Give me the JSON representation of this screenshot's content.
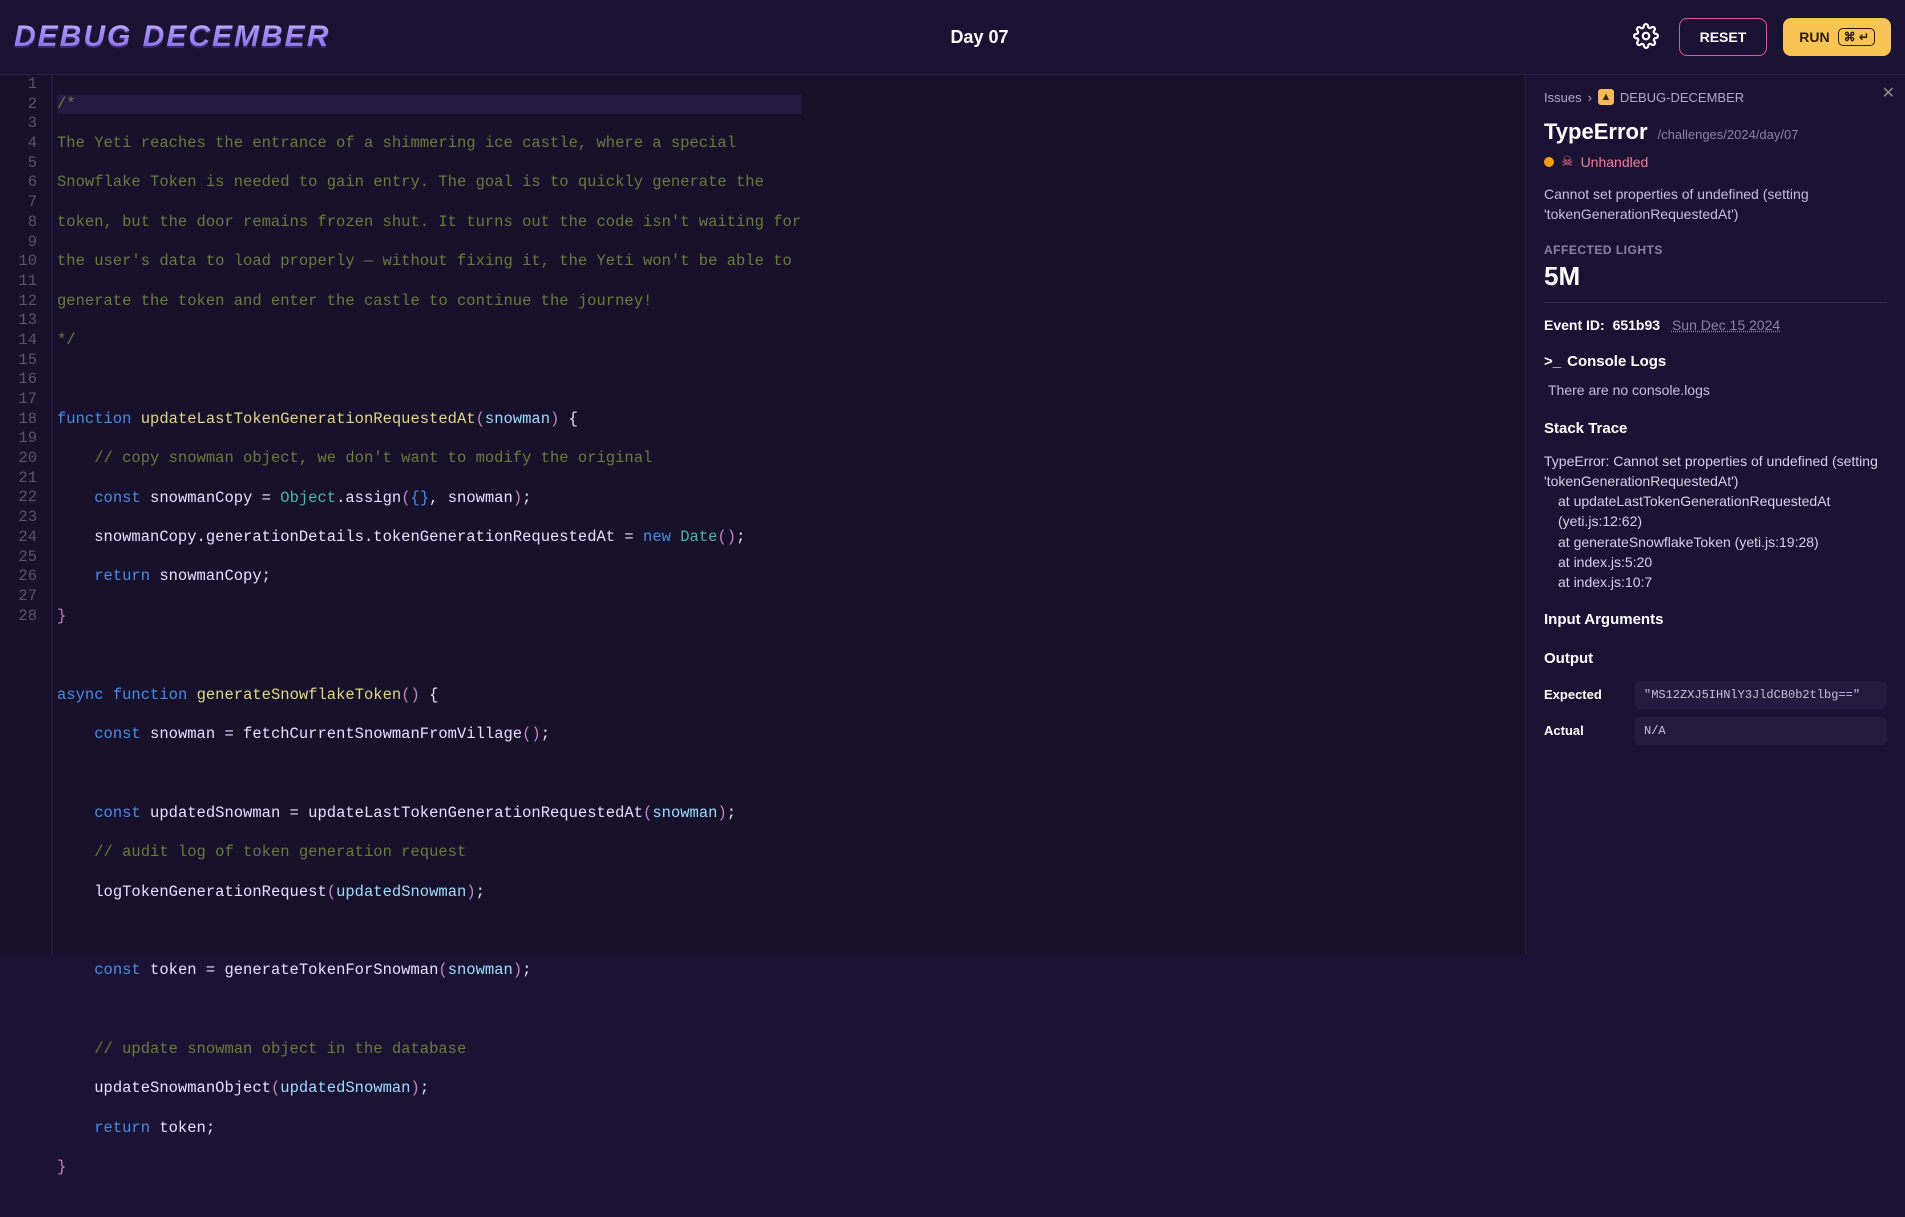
{
  "header": {
    "logo": "DEBUG DECEMBER",
    "day": "Day 07",
    "reset": "RESET",
    "run": "RUN",
    "shortcut": "⌘ ↵"
  },
  "code": {
    "lines": 28,
    "l1": "/*",
    "l2": "The Yeti reaches the entrance of a shimmering ice castle, where a special",
    "l3": "Snowflake Token is needed to gain entry. The goal is to quickly generate the",
    "l4": "token, but the door remains frozen shut. It turns out the code isn't waiting for",
    "l5": "the user's data to load properly — without fixing it, the Yeti won't be able to",
    "l6": "generate the token and enter the castle to continue the journey!",
    "l7": "*/",
    "l9a": "function",
    "l9b": "updateLastTokenGenerationRequestedAt",
    "l9c": "(",
    "l9d": "snowman",
    "l9e": ")",
    "l9f": " {",
    "l10": "// copy snowman object, we don't want to modify the original",
    "l11a": "const",
    "l11b": " snowmanCopy = ",
    "l11c": "Object",
    "l11d": ".assign",
    "l11e": "(",
    "l11f": "{}",
    "l11g": ", snowman",
    "l11h": ")",
    "l11i": ";",
    "l12a": "snowmanCopy.generationDetails.tokenGenerationRequestedAt = ",
    "l12b": "new",
    "l12c": "Date",
    "l12d": "(",
    "l12e": ")",
    "l12f": ";",
    "l13a": "return",
    "l13b": " snowmanCopy;",
    "l14": "}",
    "l16a": "async",
    "l16b": "function",
    "l16c": "generateSnowflakeToken",
    "l16d": "(",
    "l16e": ")",
    "l16f": " {",
    "l17a": "const",
    "l17b": " snowman = fetchCurrentSnowmanFromVillage",
    "l17c": "(",
    "l17d": ")",
    "l17e": ";",
    "l19a": "const",
    "l19b": " updatedSnowman = updateLastTokenGenerationRequestedAt",
    "l19c": "(",
    "l19d": "snowman",
    "l19e": ")",
    "l19f": ";",
    "l20": "// audit log of token generation request",
    "l21a": "logTokenGenerationRequest",
    "l21b": "(",
    "l21c": "updatedSnowman",
    "l21d": ")",
    "l21e": ";",
    "l23a": "const",
    "l23b": " token = generateTokenForSnowman",
    "l23c": "(",
    "l23d": "snowman",
    "l23e": ")",
    "l23f": ";",
    "l25": "// update snowman object in the database",
    "l26a": "updateSnowmanObject",
    "l26b": "(",
    "l26c": "updatedSnowman",
    "l26d": ")",
    "l26e": ";",
    "l27a": "return",
    "l27b": " token;",
    "l28": "}"
  },
  "sidebar": {
    "breadcrumb_issues": "Issues",
    "breadcrumb_project": "DEBUG-DECEMBER",
    "error_title": "TypeError",
    "error_path": "/challenges/2024/day/07",
    "unhandled": "Unhandled",
    "error_message": "Cannot set properties of undefined (setting 'tokenGenerationRequestedAt')",
    "affected_label": "AFFECTED LIGHTS",
    "affected_value": "5M",
    "event_id_label": "Event ID:",
    "event_id_value": "651b93",
    "event_date": "Sun Dec 15 2024",
    "console_header": "Console Logs",
    "console_prefix": ">_",
    "console_empty": "There are no console.logs",
    "stack_header": "Stack Trace",
    "stack_l1": "TypeError: Cannot set properties of undefined (setting 'tokenGenerationRequestedAt')",
    "stack_l2": "at updateLastTokenGenerationRequestedAt (yeti.js:12:62)",
    "stack_l3": "at generateSnowflakeToken (yeti.js:19:28)",
    "stack_l4": "at index.js:5:20",
    "stack_l5": "at index.js:10:7",
    "input_args": "Input Arguments",
    "output_header": "Output",
    "expected_label": "Expected",
    "expected_value": "\"MS12ZXJ5IHNlY3JldCB0b2tlbg==\"",
    "actual_label": "Actual",
    "actual_value": "N/A"
  }
}
